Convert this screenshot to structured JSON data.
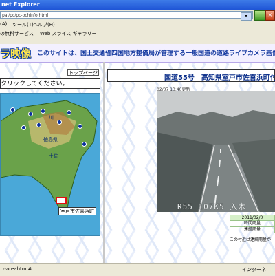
{
  "window": {
    "title": "net Explorer"
  },
  "address": {
    "url": "pal/pc/pc-ochinfo.html"
  },
  "menu": {
    "items": [
      "(A)",
      "ツール(T)",
      "ヘルプ(H)"
    ]
  },
  "favorites": {
    "items": [
      "の無料サービス",
      "Web スライス ギャラリー"
    ]
  },
  "banner": {
    "logo": "ラ映像",
    "tagline": "このサイトは、国土交通省四国地方整備局が管理する一般国道の道路ライブカメラ画像を"
  },
  "left": {
    "top_page_button": "トップページ",
    "instruction": "クリックしてください。",
    "map_labels": [
      "川",
      "徳島県",
      "土佐"
    ],
    "selected_camera_label": "室戸市佐喜浜町"
  },
  "right": {
    "route_title": "国道55号　高知県室戸市佐喜浜町付",
    "updated": "02/07 13:40更新",
    "photo_caption": "R55 107K5 入木",
    "table": [
      "2011/02/0",
      "時間雨量",
      "連続雨量"
    ],
    "note": "この付近は連続雨量が"
  },
  "status": {
    "left": "r-areahtml#",
    "zone": "インターネ"
  },
  "colors": {
    "banner_text": "#153aa0",
    "map_sea": "#4aa8d8",
    "table_border": "#9ac48a"
  }
}
